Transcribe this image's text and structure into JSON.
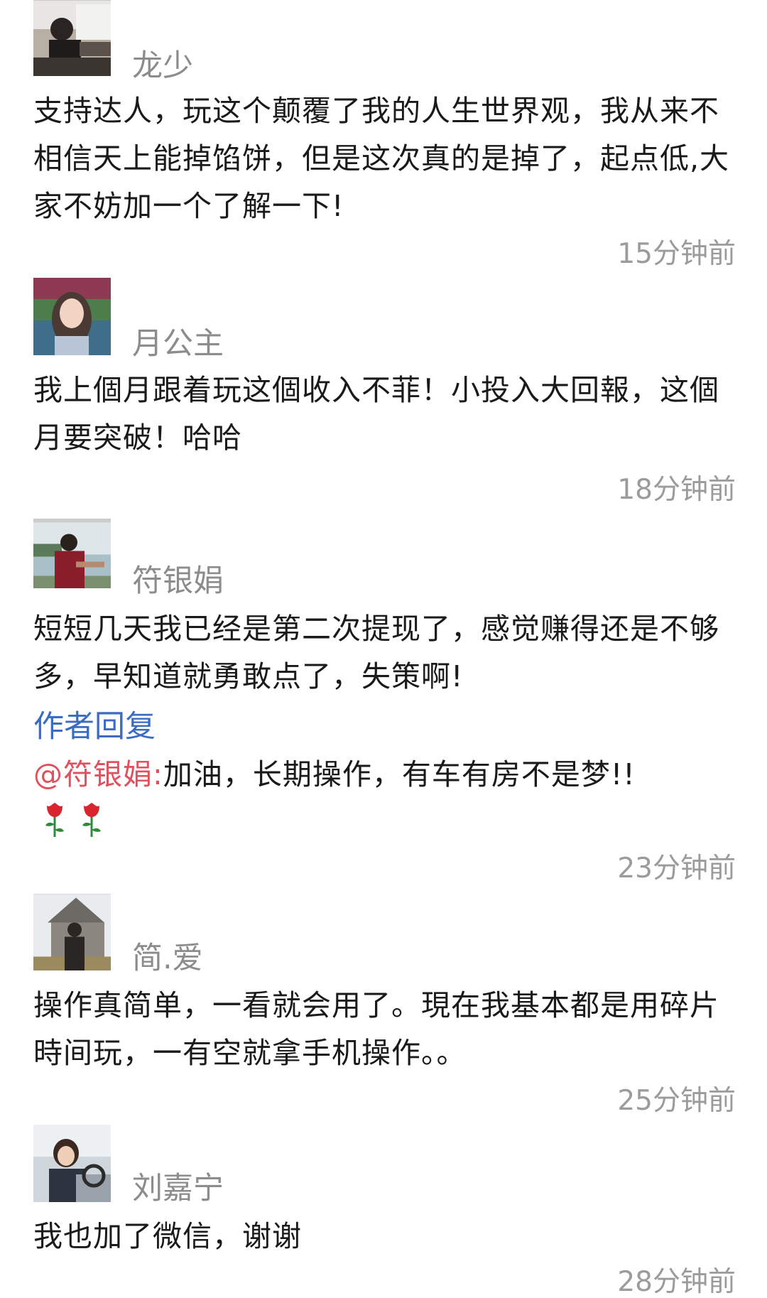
{
  "comments": [
    {
      "name": "龙少",
      "text": "支持达人，玩这个颠覆了我的人生世界观，我从来不相信天上能掉馅饼，但是这次真的是掉了，起点低,大家不妨加一个了解一下!",
      "time": "15分钟前",
      "avatar_icon": "driver-avatar"
    },
    {
      "name": "月公主",
      "text": "我上個月跟着玩这個收入不菲！小投入大回報，这個月要突破！哈哈",
      "time": "18分钟前",
      "avatar_icon": "woman-avatar"
    },
    {
      "name": "符银娟",
      "text": "短短几天我已经是第二次提现了，感觉赚得还是不够多，早知道就勇敢点了，失策啊!",
      "time": "23分钟前",
      "avatar_icon": "lake-avatar",
      "author_reply": {
        "label": "作者回复",
        "mention": "@符银娟:",
        "text": "加油，长期操作，有车有房不是梦!!",
        "emoji": "rose-icon"
      }
    },
    {
      "name": "简.爱",
      "text": "操作真简单，一看就会用了。現在我基本都是用碎片時间玩，一有空就拿手机操作。。",
      "time": "25分钟前",
      "avatar_icon": "church-avatar"
    },
    {
      "name": "刘嘉宁",
      "text": "我也加了微信，谢谢",
      "time": "28分钟前",
      "avatar_icon": "car-avatar"
    }
  ]
}
